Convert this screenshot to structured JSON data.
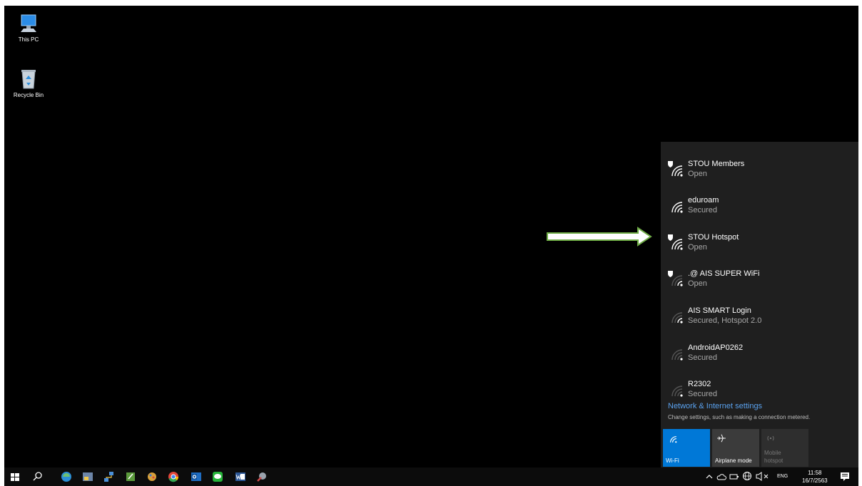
{
  "desktop": {
    "icons": [
      {
        "label": "This PC"
      },
      {
        "label": "Recycle Bin"
      }
    ]
  },
  "wifi_flyout": {
    "networks": [
      {
        "name": "STOU Members",
        "status": "Open"
      },
      {
        "name": "eduroam",
        "status": "Secured"
      },
      {
        "name": "STOU Hotspot",
        "status": "Open"
      },
      {
        "name": ".@ AIS SUPER WiFi",
        "status": "Open"
      },
      {
        "name": "AIS SMART Login",
        "status": "Secured, Hotspot 2.0"
      },
      {
        "name": "AndroidAP0262",
        "status": "Secured"
      },
      {
        "name": "R2302",
        "status": "Secured"
      }
    ],
    "settings_link": "Network & Internet settings",
    "settings_description": "Change settings, such as making a connection metered.",
    "quick_actions": [
      {
        "label": "Wi-Fi",
        "state": "on",
        "color": "#0078d7"
      },
      {
        "label": "Airplane mode",
        "state": "off",
        "color": "#3b3b3b"
      },
      {
        "label": "Mobile hotspot",
        "state": "disabled",
        "color": "#2e2e2e"
      }
    ]
  },
  "annotation": {
    "arrow_color": "#70ad47"
  },
  "taskbar": {
    "language": "ENG",
    "time": "11:58",
    "date": "16/7/2563"
  }
}
